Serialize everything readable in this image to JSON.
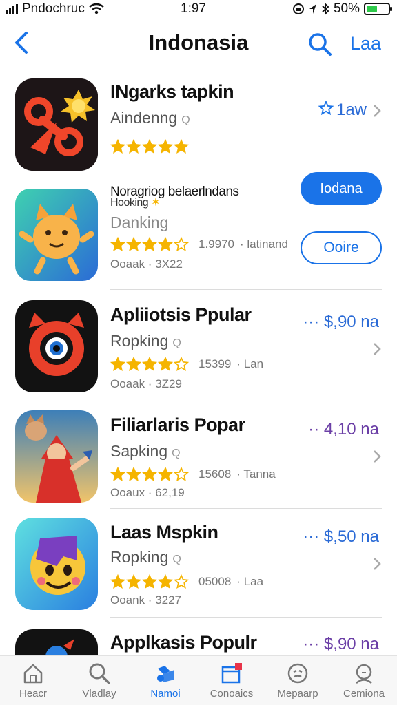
{
  "status_bar": {
    "carrier": "Pndochruc",
    "time": "1:97",
    "battery": "50%",
    "battery_level": 0.5
  },
  "nav": {
    "title": "Indonasia",
    "right_link": "Laa"
  },
  "apps": [
    {
      "name": "INgarks tapkin",
      "subtitle": "Aindenng",
      "rating_stars": 5,
      "price": "1aw",
      "icon": "scissors-sun-icon"
    },
    {
      "name": "Noragriog belaerlndans",
      "name_line2": "Hooking",
      "subtitle": "Danking",
      "rating_stars": 4,
      "rating_count": "1.9970",
      "rating_extra": "· latinand",
      "meta": "Ooaak · 3X22",
      "button_primary": "Iodana",
      "button_secondary": "Ooire",
      "icon": "cat-icon"
    },
    {
      "name": "Apliiotsis Ppular",
      "subtitle": "Ropking",
      "rating_stars": 4,
      "rating_count": "15399",
      "rating_extra": "· Lan",
      "meta": "Ooaak · 3Z29",
      "price": "··· $,90 na",
      "icon": "red-eye-icon"
    },
    {
      "name": "Filiarlaris Popar",
      "subtitle": "Sapking",
      "rating_stars": 4,
      "rating_count": "15608",
      "rating_extra": "· Tanna",
      "meta": "Ooaux · 62,19",
      "price": "·· 4,10 na",
      "icon": "fox-character-icon"
    },
    {
      "name": "Laas Mspkin",
      "subtitle": "Ropking",
      "rating_stars": 4,
      "rating_count": "05008",
      "rating_extra": "· Laa",
      "meta": "Ooank · 3227",
      "price": "··· $,50 na",
      "icon": "smiley-icon"
    },
    {
      "name": "Applkasis Populr",
      "price": "··· $,90 na",
      "icon": "dark-app-icon"
    }
  ],
  "tabs": [
    {
      "label": "Heacr",
      "icon": "home-icon"
    },
    {
      "label": "Vladlay",
      "icon": "search-icon"
    },
    {
      "label": "Namoi",
      "icon": "apps-icon",
      "active": true
    },
    {
      "label": "Conoaics",
      "icon": "calendar-icon"
    },
    {
      "label": "Mepaarp",
      "icon": "map-icon"
    },
    {
      "label": "Cemiona",
      "icon": "profile-icon"
    }
  ],
  "colors": {
    "accent": "#1a73e8",
    "star": "#f5b400",
    "price_purple": "#6b3fa6"
  }
}
